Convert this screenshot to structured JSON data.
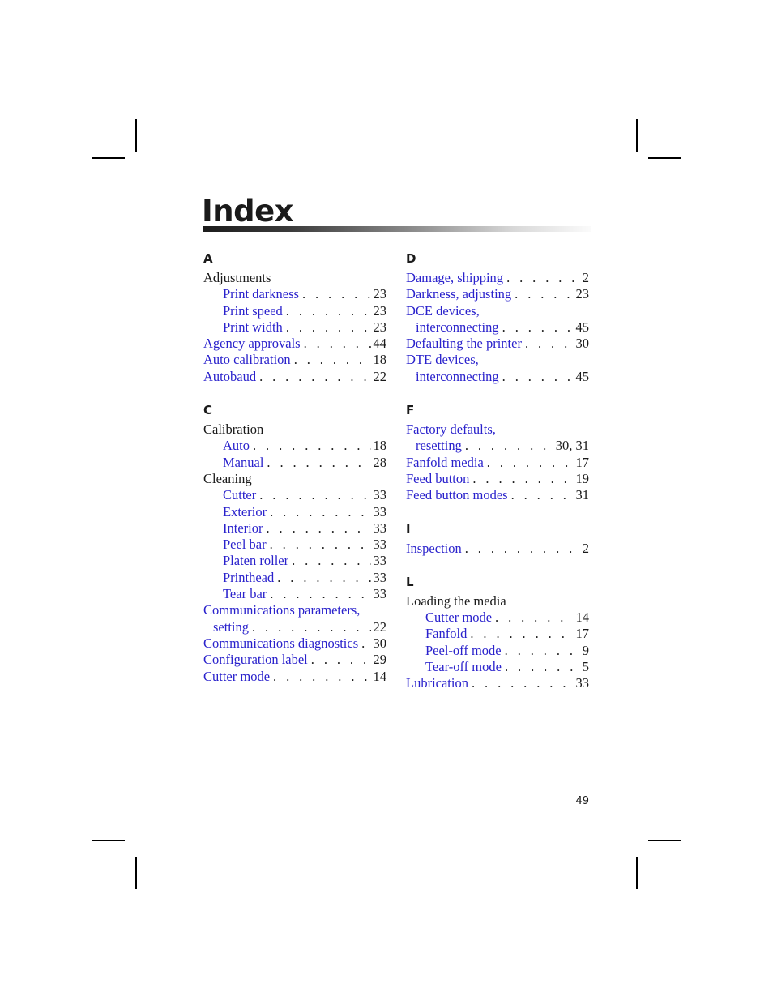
{
  "document": {
    "title": "Index",
    "folio": "49"
  },
  "columns": [
    {
      "name": "left-column",
      "sections": [
        {
          "letter": "A",
          "entries": [
            {
              "label": "Adjustments",
              "page": "",
              "style": "plain-noleader"
            },
            {
              "label": "Print darkness",
              "page": "23",
              "style": "sub"
            },
            {
              "label": "Print speed",
              "page": "23",
              "style": "sub"
            },
            {
              "label": "Print width",
              "page": "23",
              "style": "sub"
            },
            {
              "label": "Agency approvals",
              "page": "44",
              "style": "main"
            },
            {
              "label": "Auto calibration",
              "page": "18",
              "style": "main"
            },
            {
              "label": "Autobaud",
              "page": "22",
              "style": "main"
            }
          ]
        },
        {
          "letter": "C",
          "entries": [
            {
              "label": "Calibration",
              "page": "",
              "style": "plain-noleader"
            },
            {
              "label": "Auto",
              "page": "18",
              "style": "sub"
            },
            {
              "label": "Manual",
              "page": "28",
              "style": "sub"
            },
            {
              "label": "Cleaning",
              "page": "",
              "style": "plain-noleader"
            },
            {
              "label": "Cutter",
              "page": "33",
              "style": "sub"
            },
            {
              "label": "Exterior",
              "page": "33",
              "style": "sub"
            },
            {
              "label": "Interior",
              "page": "33",
              "style": "sub"
            },
            {
              "label": "Peel bar",
              "page": "33",
              "style": "sub"
            },
            {
              "label": "Platen roller",
              "page": "33",
              "style": "sub"
            },
            {
              "label": "Printhead",
              "page": "33",
              "style": "sub"
            },
            {
              "label": "Tear bar",
              "page": "33",
              "style": "sub"
            },
            {
              "label": "Communications parameters,",
              "page": "",
              "style": "main-noleader"
            },
            {
              "label": "setting",
              "page": "22",
              "style": "cont"
            },
            {
              "label": "Communications diagnostics",
              "page": "30",
              "style": "main"
            },
            {
              "label": "Configuration label",
              "page": "29",
              "style": "main"
            },
            {
              "label": "Cutter mode",
              "page": "14",
              "style": "main"
            }
          ]
        }
      ]
    },
    {
      "name": "right-column",
      "sections": [
        {
          "letter": "D",
          "entries": [
            {
              "label": "Damage, shipping",
              "page": "2",
              "style": "main"
            },
            {
              "label": "Darkness, adjusting",
              "page": "23",
              "style": "main"
            },
            {
              "label": "DCE devices,",
              "page": "",
              "style": "main-noleader"
            },
            {
              "label": "interconnecting",
              "page": "45",
              "style": "cont"
            },
            {
              "label": "Defaulting the printer",
              "page": "30",
              "style": "main"
            },
            {
              "label": "DTE devices,",
              "page": "",
              "style": "main-noleader"
            },
            {
              "label": "interconnecting",
              "page": "45",
              "style": "cont"
            }
          ]
        },
        {
          "letter": "F",
          "entries": [
            {
              "label": "Factory defaults,",
              "page": "",
              "style": "main-noleader"
            },
            {
              "label": "resetting",
              "page": "30, 31",
              "style": "cont"
            },
            {
              "label": "Fanfold media",
              "page": "17",
              "style": "main"
            },
            {
              "label": "Feed button",
              "page": "19",
              "style": "main"
            },
            {
              "label": "Feed button modes",
              "page": "31",
              "style": "main"
            }
          ]
        },
        {
          "letter": "I",
          "entries": [
            {
              "label": "Inspection",
              "page": "2",
              "style": "main"
            }
          ]
        },
        {
          "letter": "L",
          "entries": [
            {
              "label": "Loading the media",
              "page": "",
              "style": "plain-noleader"
            },
            {
              "label": "Cutter mode",
              "page": "14",
              "style": "sub"
            },
            {
              "label": "Fanfold",
              "page": "17",
              "style": "sub"
            },
            {
              "label": "Peel-off mode",
              "page": "9",
              "style": "sub"
            },
            {
              "label": "Tear-off mode",
              "page": "5",
              "style": "sub"
            },
            {
              "label": "Lubrication",
              "page": "33",
              "style": "main"
            }
          ]
        }
      ]
    }
  ]
}
